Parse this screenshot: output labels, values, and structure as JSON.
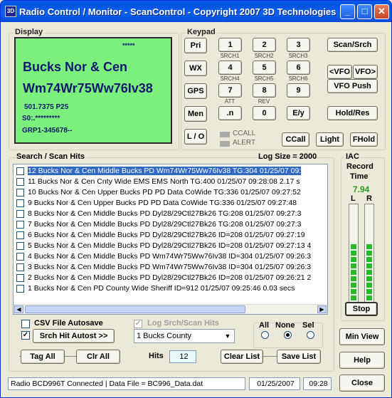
{
  "window": {
    "title": "Radio Control / Monitor - ScanControl - Copyright 2007 3D Technologies",
    "icon_text": "3D",
    "minimize": "_",
    "maximize": "□",
    "close": "✕"
  },
  "display": {
    "label": "Display",
    "stars": "*****",
    "line1": "Bucks Nor & Cen",
    "line2": "Wm74Wr75Ww76Iv38",
    "freq": "501.7375 P25",
    "s0": "S0:.*********",
    "grp": "GRP1-345678--"
  },
  "keypad": {
    "label": "Keypad",
    "side": [
      "Pri",
      "WX",
      "GPS",
      "Men",
      "L / O"
    ],
    "keys": [
      {
        "k": "1",
        "sub": "SRCH1"
      },
      {
        "k": "2",
        "sub": "SRCH2"
      },
      {
        "k": "3",
        "sub": "SRCH3"
      },
      {
        "k": "4",
        "sub": "SRCH4"
      },
      {
        "k": "5",
        "sub": "SRCH5"
      },
      {
        "k": "6",
        "sub": "SRCH6"
      },
      {
        "k": "7",
        "sub": "ATT"
      },
      {
        "k": "8",
        "sub": "REV"
      },
      {
        "k": "9",
        "sub": ""
      },
      {
        "k": ".n",
        "sub": ""
      },
      {
        "k": "0",
        "sub": ""
      },
      {
        "k": "E/y",
        "sub": ""
      }
    ],
    "scan_srch": "Scan/Srch",
    "vfo_left": "<VFO",
    "vfo_right": "VFO>",
    "vfo_push": "VFO Push",
    "hold_res": "Hold/Res",
    "ccall_led": "CCALL",
    "alert_led": "ALERT",
    "ccall_btn": "CCall",
    "light_btn": "Light",
    "fhold_btn": "FHold"
  },
  "hits": {
    "label": "Search / Scan Hits",
    "log_size": "Log Size = 2000",
    "rows": [
      "12  Bucks Nor & Cen  Middle Bucks PD   Wm74Wr75Ww76Iv38   TG:304  01/25/07  09:",
      "11  Bucks Nor & Cen  Cnty Wide EMS   EMS North   TG:400  01/25/07  09:28:08  2.17 s",
      "10  Bucks Nor & Cen  Upper Bucks PD   PD Data CoWide   TG:336  01/25/07  09:27:52",
      "9  Bucks Nor & Cen  Upper Bucks PD   PD Data CoWide   TG:336  01/25/07  09:27:48",
      "8  Bucks Nor & Cen  Middle Bucks PD   Dyl28/29Ctl27Bk26   TG:208  01/25/07  09:27:3",
      "7  Bucks Nor & Cen  Middle Bucks PD   Dyl28/29Ctl27Bk26   TG:208  01/25/07  09:27:3",
      "6 Bucks Nor & Cen Middle Bucks PD Dyl28/29Ctl27Bk26  ID=208  01/25/07  09:27:19",
      "5 Bucks Nor & Cen Middle Bucks PD Dyl28/29Ctl27Bk26  ID=208  01/25/07  09:27:13  4",
      "4 Bucks Nor & Cen Middle Bucks PD Wm74Wr75Ww76Iv38  ID=304  01/25/07  09:26:3",
      "3 Bucks Nor & Cen Middle Bucks PD Wm74Wr75Ww76Iv38  ID=304  01/25/07  09:26:3",
      "2 Bucks Nor & Cen Middle Bucks PD Dyl28/29Ctl27Bk26  ID=208  01/25/07  09:26:21  2",
      "1 Bucks Nor & Cen PD County Wide Sheriff  ID=912  01/25/07  09:25:46  0.03 secs"
    ]
  },
  "controls": {
    "csv_autosave": "CSV File Autosave",
    "log_srch": "Log Srch/Scan Hits",
    "srch_autost": "Srch Hit Autost >>",
    "county": "1 Bucks County",
    "all": "All",
    "none": "None",
    "sel": "Sel",
    "tag_all": "Tag All",
    "clr_all": "Clr All",
    "hits_label": "Hits",
    "hits_value": "12",
    "clear_list": "Clear List",
    "save_list": "Save List"
  },
  "iac": {
    "label": "IAC",
    "record": "Record",
    "time": "Time",
    "value": "7.94",
    "left": "L",
    "right": "R",
    "left_level": 0.58,
    "right_level": 0.58,
    "stop": "Stop"
  },
  "right_buttons": {
    "min_view": "Min View",
    "help": "Help",
    "close": "Close"
  },
  "status": {
    "main": "Radio BCD996T Connected | Data File = BC996_Data.dat",
    "date": "01/25/2007",
    "time": "09:28"
  },
  "colors": {
    "lcd": "#7cf07c",
    "selection": "#316ac5",
    "meter": "#26b826",
    "record_time": "#20a020"
  }
}
